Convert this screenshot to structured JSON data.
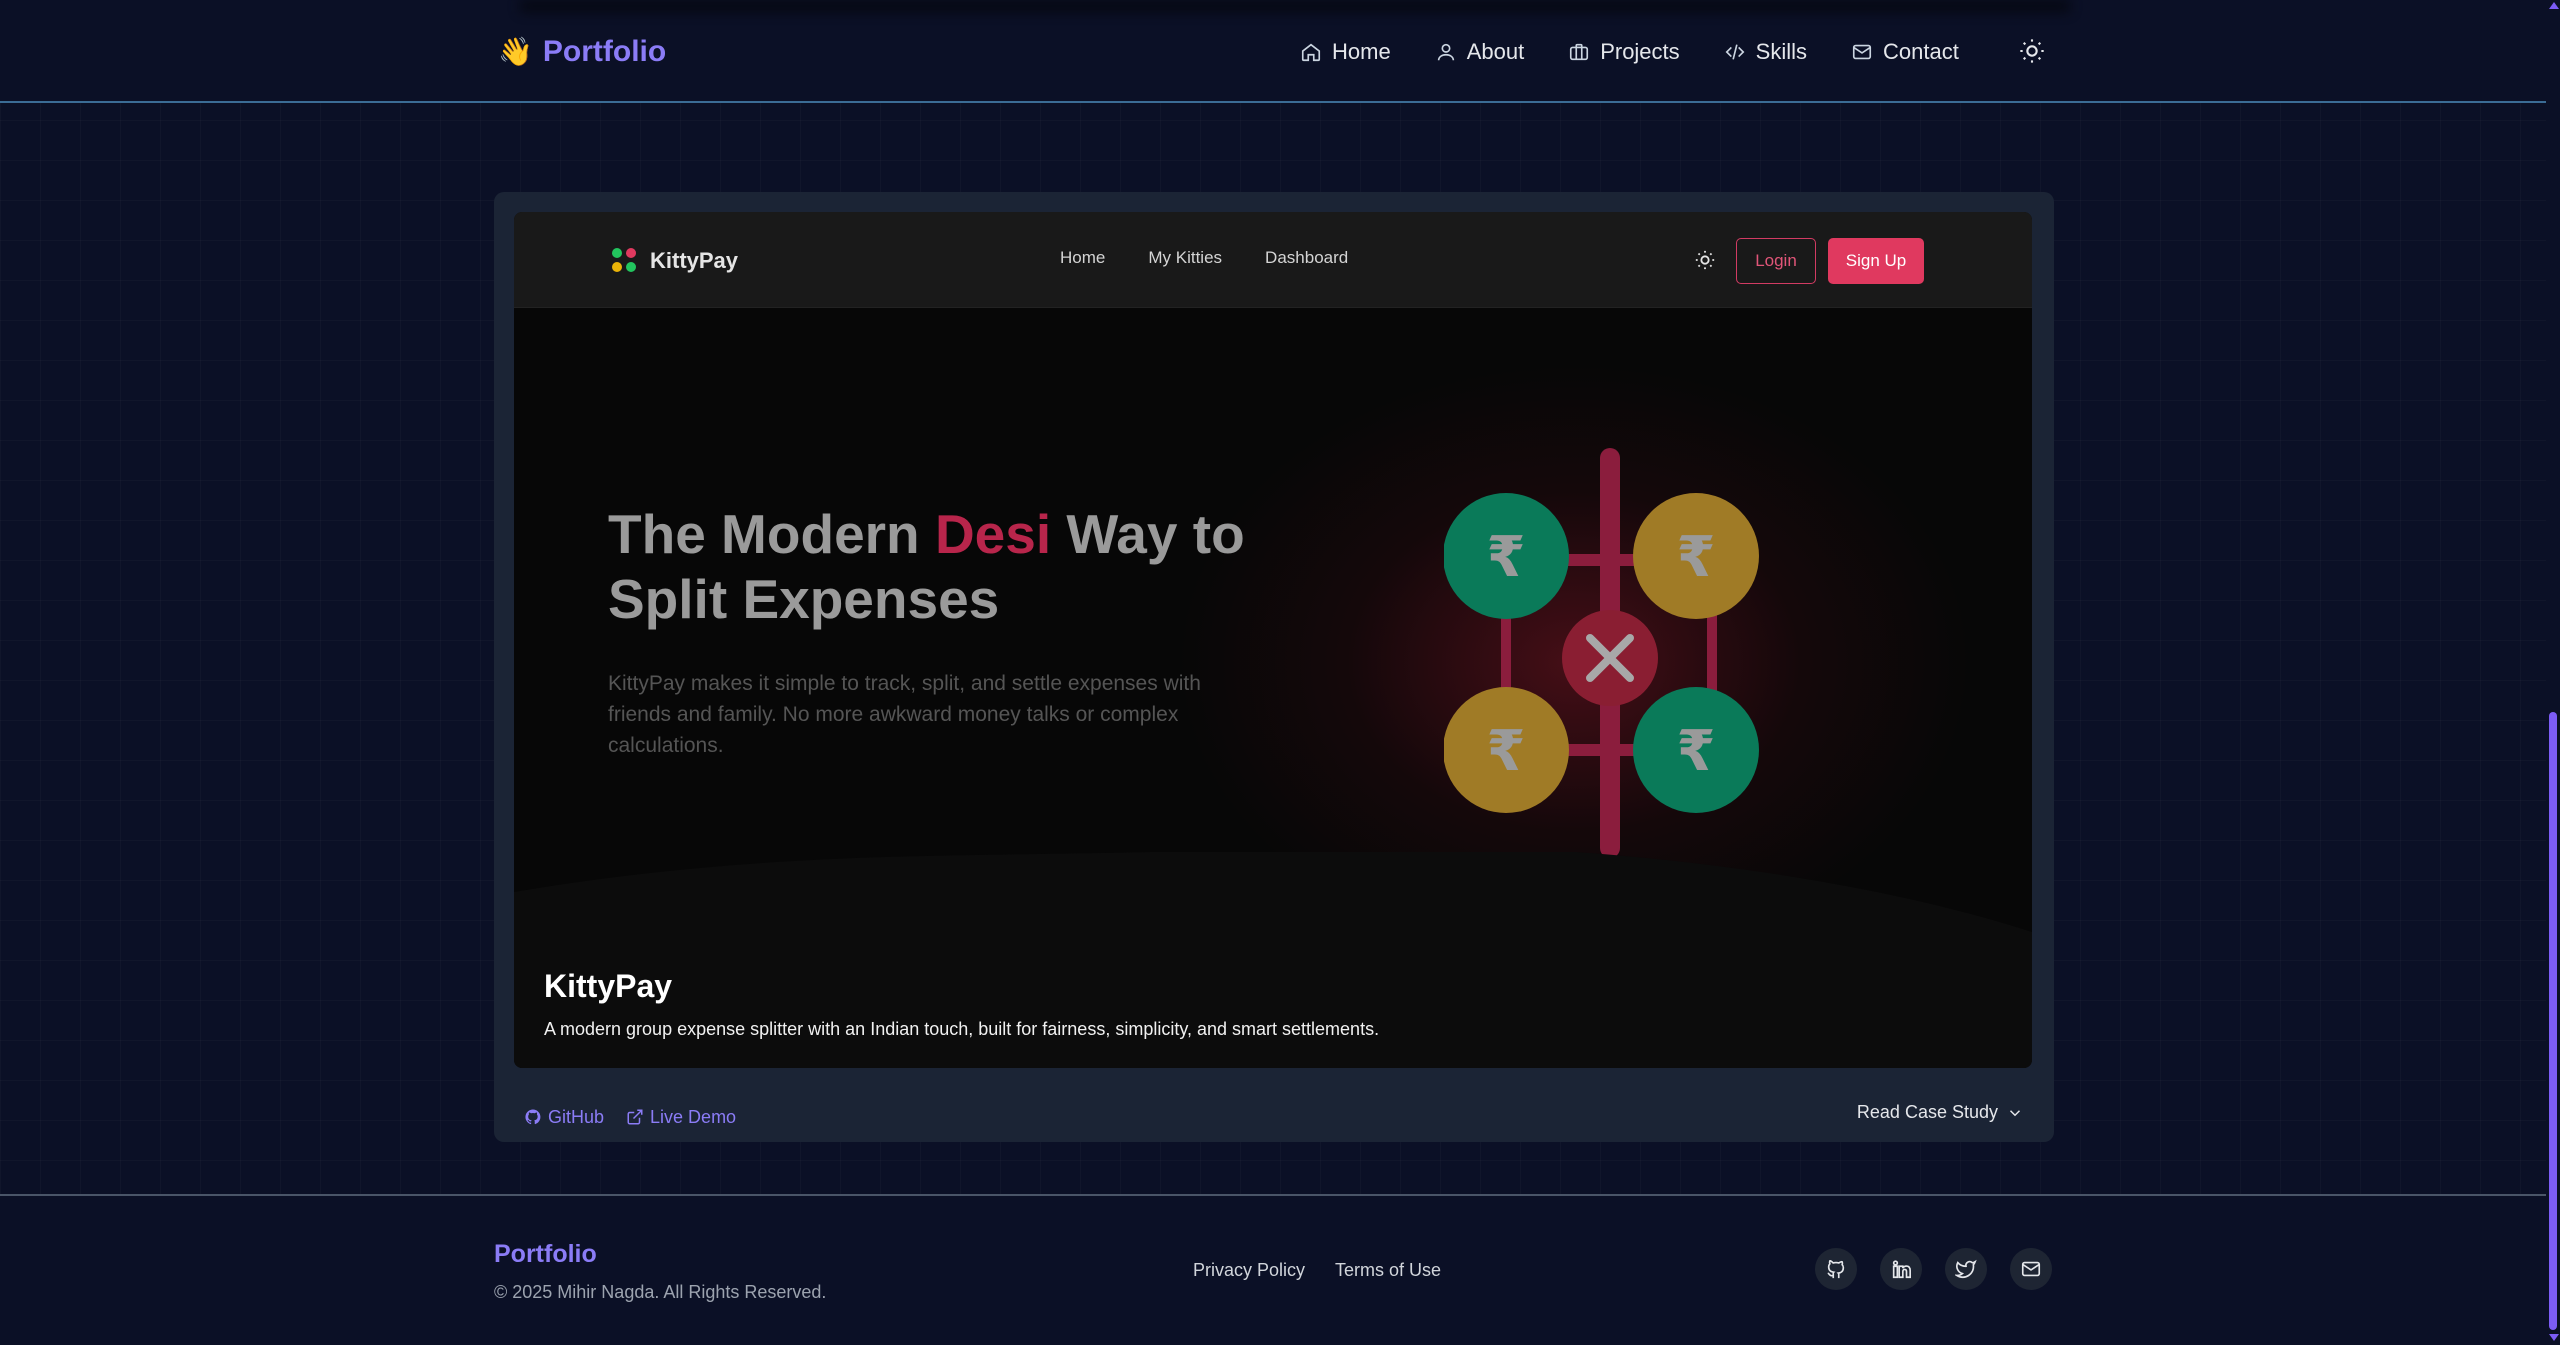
{
  "nav": {
    "brand": "Portfolio",
    "brand_emoji": "👋",
    "links": [
      {
        "label": "Home",
        "icon": "home-icon"
      },
      {
        "label": "About",
        "icon": "user-icon"
      },
      {
        "label": "Projects",
        "icon": "briefcase-icon"
      },
      {
        "label": "Skills",
        "icon": "code-icon"
      },
      {
        "label": "Contact",
        "icon": "mail-icon"
      }
    ],
    "theme_icon": "sun-icon"
  },
  "project": {
    "preview": {
      "brand": "KittyPay",
      "links": [
        "Home",
        "My Kitties",
        "Dashboard"
      ],
      "login": "Login",
      "signup": "Sign Up",
      "headline_pre": "The Modern ",
      "headline_accent": "Desi",
      "headline_post": " Way to Split Expenses",
      "subcopy": "KittyPay makes it simple to track, split, and settle expenses with friends and family. No more awkward money talks or complex calculations.",
      "accent_color": "#e0395f"
    },
    "title": "KittyPay",
    "description": "A modern group expense splitter with an Indian touch, built for fairness, simplicity, and smart settlements.",
    "github_label": "GitHub",
    "demo_label": "Live Demo",
    "case_study_label": "Read Case Study"
  },
  "footer": {
    "brand": "Portfolio",
    "copyright": "© 2025 Mihir Nagda. All Rights Reserved.",
    "links": [
      "Privacy Policy",
      "Terms of Use"
    ],
    "socials": [
      "github-icon",
      "linkedin-icon",
      "twitter-icon",
      "mail-icon"
    ]
  },
  "colors": {
    "background": "#0b1026",
    "brand": "#8b7cf6",
    "card": "#1b2435"
  }
}
